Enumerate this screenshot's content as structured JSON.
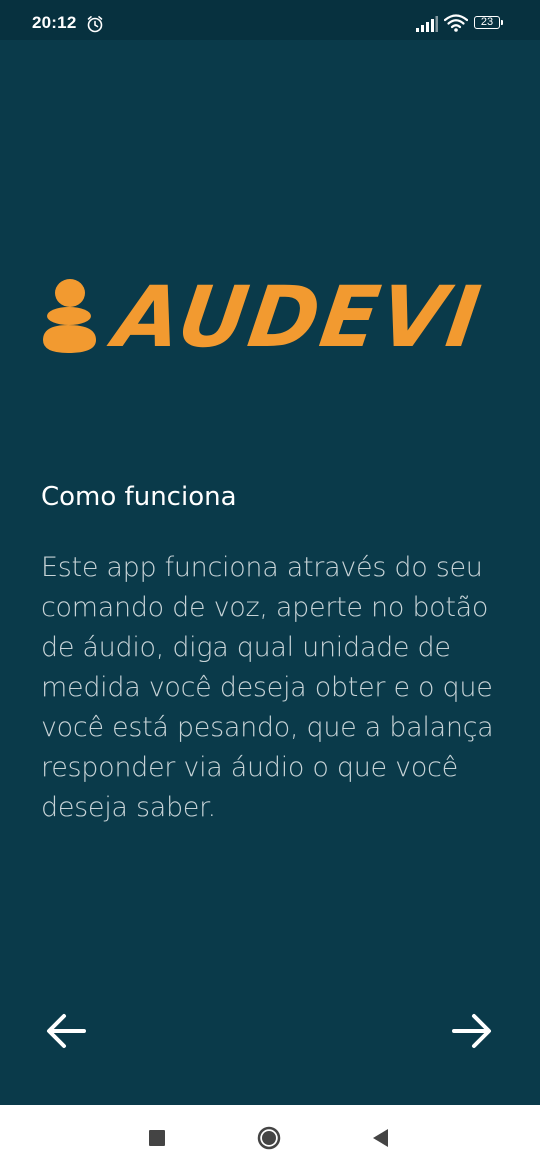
{
  "status_bar": {
    "time": "20:12",
    "battery_level": "23",
    "icons": [
      "alarm-icon",
      "signal-icon",
      "wifi-icon",
      "battery-icon"
    ]
  },
  "logo": {
    "text": "AUDEVI",
    "icon": "person-icon",
    "color": "#f29a30"
  },
  "content": {
    "title": "Como funciona",
    "description": "Este app funciona através do seu comando de voz, aperte no botão de áudio, diga qual unidade de medida você deseja obter e o que você está pesando, que a balança responder via áudio o que você deseja saber."
  },
  "navigation": {
    "back_icon": "arrow-left-icon",
    "next_icon": "arrow-right-icon"
  },
  "system_nav": {
    "icons": [
      "recent-apps-icon",
      "home-icon",
      "back-icon"
    ]
  },
  "colors": {
    "background": "#0a3a4a",
    "status_bar": "#07313f",
    "accent": "#f29a30",
    "text_primary": "#ffffff",
    "text_secondary": "#c7d3d7"
  }
}
